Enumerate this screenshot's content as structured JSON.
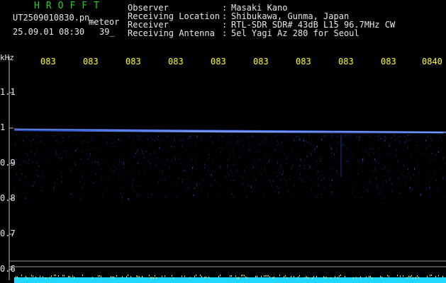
{
  "header": {
    "title": "HROFFT",
    "filename": "UT2509010830.pn_",
    "meteor_label": "meteor",
    "datetime": "25.09.01 08:30",
    "count": "39_"
  },
  "metadata": [
    {
      "label": "Observer",
      "colon": ":",
      "value": "Masaki Kano"
    },
    {
      "label": "Receiving Location",
      "colon": ":",
      "value": "Shibukawa, Gunma, Japan"
    },
    {
      "label": "Receiver",
      "colon": ":",
      "value": "RTL-SDR SDR# 43dB L15 96.7MHz CW"
    },
    {
      "label": "Receiving Antenna",
      "colon": ":",
      "value": "5el Yagi Az 280 for Seoul"
    }
  ],
  "axis": {
    "unit": "kHz",
    "y_ticks": [
      "1.1",
      "1",
      "0.9",
      "0.8",
      "0.7",
      "0.6"
    ],
    "x_ticks": [
      "083",
      "083",
      "083",
      "083",
      "083",
      "083",
      "083",
      "083",
      "083",
      "0840"
    ]
  },
  "colors": {
    "background": "#000000",
    "text": "#e8e8e8",
    "title": "#20d020",
    "time_axis": "#ffff20",
    "carrier": "#3a6cff",
    "bottom_band": "#20d8ff"
  }
}
